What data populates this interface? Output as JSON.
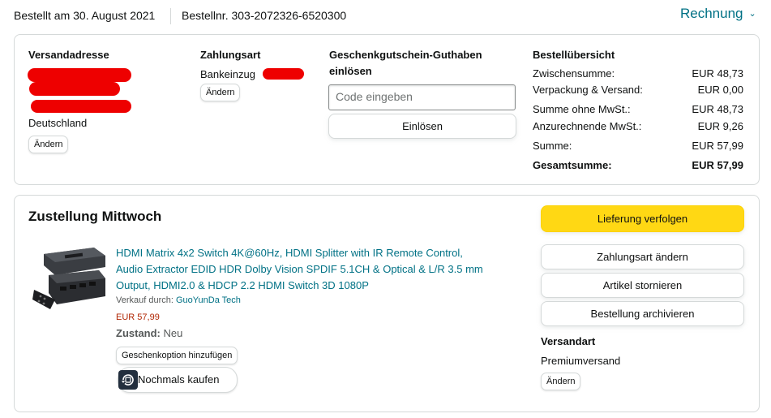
{
  "header": {
    "order_date": "Bestellt am 30. August 2021",
    "order_number": "Bestellnr. 303-2072326-6520300",
    "invoice_label": "Rechnung",
    "invoice_chevron": "⌄"
  },
  "shipping_address": {
    "heading": "Versandadresse",
    "country": "Deutschland",
    "change_label": "Ändern"
  },
  "payment": {
    "heading": "Zahlungsart",
    "method": "Bankeinzug",
    "change_label": "Ändern"
  },
  "gift_card": {
    "heading_line1": "Geschenkgutschein-Guthaben",
    "heading_line2": "einlösen",
    "input_placeholder": "Code eingeben",
    "redeem_label": "Einlösen"
  },
  "summary": {
    "heading": "Bestellübersicht",
    "rows": [
      {
        "label": "Zwischensumme:",
        "value": "EUR 48,73"
      },
      {
        "label": "Verpackung & Versand:",
        "value": "EUR 0,00"
      },
      {
        "label": "Summe ohne MwSt.:",
        "value": "EUR 48,73"
      },
      {
        "label": "Anzurechnende MwSt.:",
        "value": "EUR 9,26"
      },
      {
        "label": "Summe:",
        "value": "EUR 57,99"
      },
      {
        "label": "Gesamtsumme:",
        "value": "EUR 57,99"
      }
    ]
  },
  "delivery": {
    "title": "Zustellung Mittwoch",
    "product": {
      "title_lines": [
        "HDMI Matrix 4x2 Switch 4K@60Hz, HDMI Splitter with IR Remote Control,",
        "Audio Extractor EDID HDR Dolby Vision SPDIF 5.1CH & Optical & L/R 3.5 mm",
        "Output, HDMI2.0 & HDCP 2.2 HDMI Switch 3D 1080P"
      ],
      "sold_by_label": "Verkauf durch:",
      "seller": "GuoYunDa Tech",
      "price": "EUR 57,99",
      "condition_label": "Zustand:",
      "condition": "Neu",
      "gift_option_label": "Geschenkoption hinzufügen",
      "buy_again_label": "Nochmals kaufen"
    },
    "actions": {
      "track": "Lieferung verfolgen",
      "change_payment": "Zahlungsart ändern",
      "cancel_items": "Artikel stornieren",
      "archive": "Bestellung archivieren"
    },
    "shipping_method": {
      "heading": "Versandart",
      "value": "Premiumversand",
      "change_label": "Ändern"
    }
  },
  "colors": {
    "link": "#007185",
    "primary_button": "#FFD814",
    "price": "#B12704",
    "redaction": "#EE0000"
  }
}
